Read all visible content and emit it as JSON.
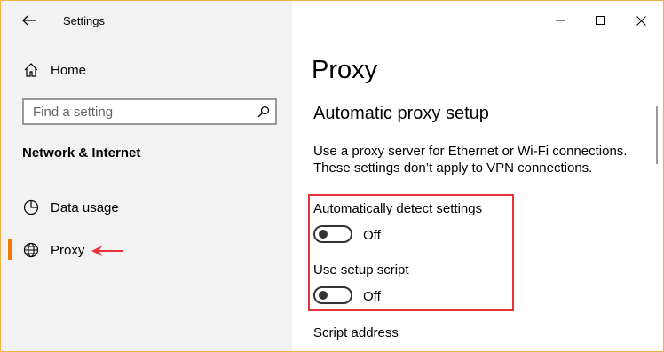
{
  "titlebar": {
    "app_title": "Settings",
    "back_icon": "arrow-left-icon",
    "minimize_icon": "minimize-icon",
    "maximize_icon": "maximize-icon",
    "close_icon": "close-icon"
  },
  "sidebar": {
    "home_label": "Home",
    "search": {
      "placeholder": "Find a setting",
      "value": ""
    },
    "section_heading": "Network & Internet",
    "items": [
      {
        "label": "Data usage",
        "icon": "pie-chart-icon"
      },
      {
        "label": "Proxy",
        "icon": "globe-icon",
        "selected": true
      }
    ],
    "accent_color": "#f07d00"
  },
  "main": {
    "page_title": "Proxy",
    "section_title": "Automatic proxy setup",
    "description": [
      "Use a proxy server for Ethernet or Wi-Fi connections.",
      "These settings don’t apply to VPN connections."
    ],
    "settings": [
      {
        "label": "Automatically detect settings",
        "state": "Off"
      },
      {
        "label": "Use setup script",
        "state": "Off"
      }
    ],
    "script_address_label": "Script address"
  },
  "annotations": {
    "highlight_color": "#e8323a"
  }
}
